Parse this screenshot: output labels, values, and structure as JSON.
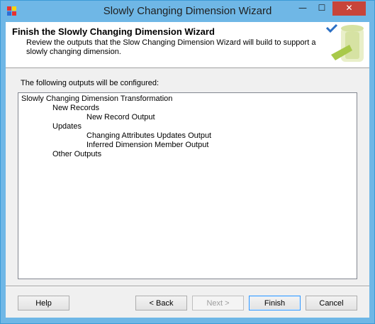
{
  "window": {
    "title": "Slowly Changing Dimension Wizard"
  },
  "titlebar": {
    "minimize": "—",
    "maximize": "☐",
    "close": "✕"
  },
  "header": {
    "title": "Finish the Slowly Changing Dimension Wizard",
    "description": "Review the outputs that the Slow Changing Dimension Wizard will build to support a slowly changing dimension."
  },
  "main": {
    "intro": "The following outputs will be configured:",
    "outputs": [
      {
        "text": "Slowly Changing Dimension Transformation",
        "level": 0
      },
      {
        "text": "New Records",
        "level": 1
      },
      {
        "text": "New Record Output",
        "level": 2
      },
      {
        "text": "Updates",
        "level": 1
      },
      {
        "text": "Changing Attributes Updates Output",
        "level": 2
      },
      {
        "text": "Inferred Dimension Member Output",
        "level": 2
      },
      {
        "text": "Other Outputs",
        "level": 1
      }
    ]
  },
  "buttons": {
    "help": "Help",
    "back": "< Back",
    "next": "Next >",
    "finish": "Finish",
    "cancel": "Cancel"
  },
  "colors": {
    "titlebar": "#6fb7e6",
    "close": "#c7443a",
    "header_bg": "#ffffff",
    "client_bg": "#f0f0f0"
  }
}
